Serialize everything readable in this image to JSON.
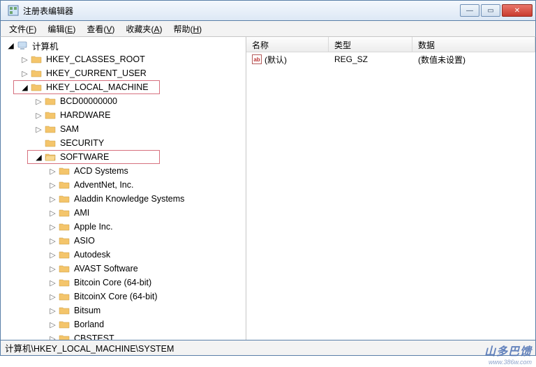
{
  "window": {
    "title": "注册表编辑器"
  },
  "menu": {
    "file": {
      "label": "文件",
      "accel": "F"
    },
    "edit": {
      "label": "编辑",
      "accel": "E"
    },
    "view": {
      "label": "查看",
      "accel": "V"
    },
    "fav": {
      "label": "收藏夹",
      "accel": "A"
    },
    "help": {
      "label": "帮助",
      "accel": "H"
    }
  },
  "tree": {
    "root": "计算机",
    "hives": {
      "hkcr": "HKEY_CLASSES_ROOT",
      "hkcu": "HKEY_CURRENT_USER",
      "hklm": "HKEY_LOCAL_MACHINE",
      "hklm_children": {
        "bcd": "BCD00000000",
        "hw": "HARDWARE",
        "sam": "SAM",
        "sec": "SECURITY",
        "sw": "SOFTWARE",
        "sw_children": [
          "ACD Systems",
          "AdventNet, Inc.",
          "Aladdin Knowledge Systems",
          "AMI",
          "Apple Inc.",
          "ASIO",
          "Autodesk",
          "AVAST Software",
          "Bitcoin Core (64-bit)",
          "BitcoinX Core (64-bit)",
          "Bitsum",
          "Borland",
          "CBSTEST"
        ]
      }
    }
  },
  "list": {
    "columns": {
      "name": "名称",
      "type": "类型",
      "data": "数据"
    },
    "rows": [
      {
        "name": "(默认)",
        "type": "REG_SZ",
        "data": "(数值未设置)"
      }
    ]
  },
  "statusbar": {
    "path": "计算机\\HKEY_LOCAL_MACHINE\\SYSTEM"
  },
  "watermark": {
    "text": "山多巴馈",
    "sub": "www.386w.com"
  }
}
